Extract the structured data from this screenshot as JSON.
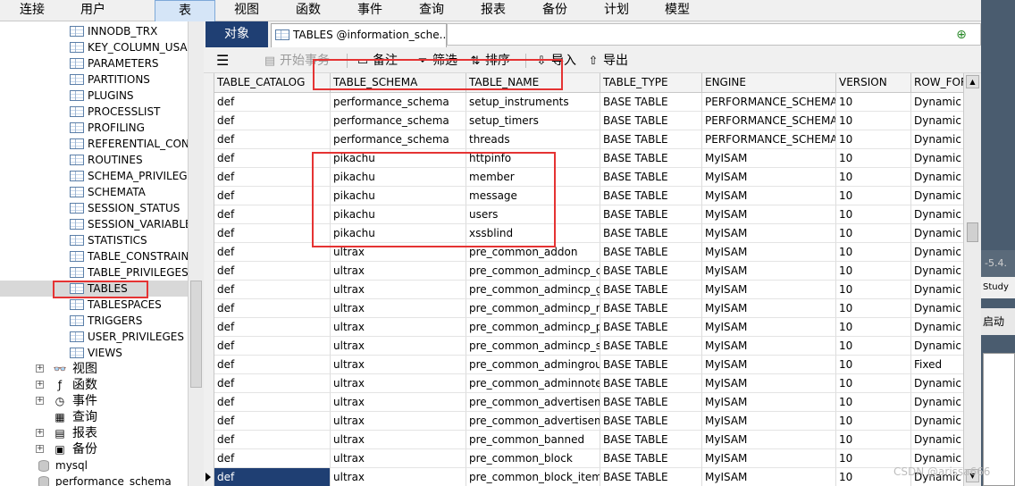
{
  "menu": [
    "连接",
    "用户",
    "表",
    "视图",
    "函数",
    "事件",
    "查询",
    "报表",
    "备份",
    "计划",
    "模型"
  ],
  "menu_active_index": 2,
  "tree": {
    "tables": [
      "INNODB_TRX",
      "KEY_COLUMN_USAGE",
      "PARAMETERS",
      "PARTITIONS",
      "PLUGINS",
      "PROCESSLIST",
      "PROFILING",
      "REFERENTIAL_CONSTRAINTS",
      "ROUTINES",
      "SCHEMA_PRIVILEGES",
      "SCHEMATA",
      "SESSION_STATUS",
      "SESSION_VARIABLES",
      "STATISTICS",
      "TABLE_CONSTRAINTS",
      "TABLE_PRIVILEGES",
      "TABLES",
      "TABLESPACES",
      "TRIGGERS",
      "USER_PRIVILEGES",
      "VIEWS"
    ],
    "selected_table": "TABLES",
    "groups": [
      {
        "label": "视图",
        "icon": "glasses-icon"
      },
      {
        "label": "函数",
        "icon": "function-icon"
      },
      {
        "label": "事件",
        "icon": "event-icon"
      },
      {
        "label": "查询",
        "icon": "query-icon"
      },
      {
        "label": "报表",
        "icon": "report-icon"
      },
      {
        "label": "备份",
        "icon": "backup-icon"
      }
    ],
    "databases": [
      "mysql",
      "performance_schema"
    ]
  },
  "tabs": {
    "objects": "对象",
    "tables_tab": "TABLES @information_sche..."
  },
  "toolbar": {
    "menu_icon": "hamburger-icon",
    "begin_tx": "开始事务",
    "note": "备注",
    "filter": "筛选",
    "sort": "排序",
    "import": "导入",
    "export": "导出"
  },
  "grid": {
    "columns": [
      "TABLE_CATALOG",
      "TABLE_SCHEMA",
      "TABLE_NAME",
      "TABLE_TYPE",
      "ENGINE",
      "VERSION",
      "ROW_FORMAT"
    ],
    "rows": [
      [
        "def",
        "performance_schema",
        "setup_instruments",
        "BASE TABLE",
        "PERFORMANCE_SCHEMA",
        "10",
        "Dynamic"
      ],
      [
        "def",
        "performance_schema",
        "setup_timers",
        "BASE TABLE",
        "PERFORMANCE_SCHEMA",
        "10",
        "Dynamic"
      ],
      [
        "def",
        "performance_schema",
        "threads",
        "BASE TABLE",
        "PERFORMANCE_SCHEMA",
        "10",
        "Dynamic"
      ],
      [
        "def",
        "pikachu",
        "httpinfo",
        "BASE TABLE",
        "MyISAM",
        "10",
        "Dynamic"
      ],
      [
        "def",
        "pikachu",
        "member",
        "BASE TABLE",
        "MyISAM",
        "10",
        "Dynamic"
      ],
      [
        "def",
        "pikachu",
        "message",
        "BASE TABLE",
        "MyISAM",
        "10",
        "Dynamic"
      ],
      [
        "def",
        "pikachu",
        "users",
        "BASE TABLE",
        "MyISAM",
        "10",
        "Dynamic"
      ],
      [
        "def",
        "pikachu",
        "xssblind",
        "BASE TABLE",
        "MyISAM",
        "10",
        "Dynamic"
      ],
      [
        "def",
        "ultrax",
        "pre_common_addon",
        "BASE TABLE",
        "MyISAM",
        "10",
        "Dynamic"
      ],
      [
        "def",
        "ultrax",
        "pre_common_admincp_cmenu",
        "BASE TABLE",
        "MyISAM",
        "10",
        "Dynamic"
      ],
      [
        "def",
        "ultrax",
        "pre_common_admincp_group",
        "BASE TABLE",
        "MyISAM",
        "10",
        "Dynamic"
      ],
      [
        "def",
        "ultrax",
        "pre_common_admincp_member",
        "BASE TABLE",
        "MyISAM",
        "10",
        "Dynamic"
      ],
      [
        "def",
        "ultrax",
        "pre_common_admincp_perm",
        "BASE TABLE",
        "MyISAM",
        "10",
        "Dynamic"
      ],
      [
        "def",
        "ultrax",
        "pre_common_admincp_session",
        "BASE TABLE",
        "MyISAM",
        "10",
        "Dynamic"
      ],
      [
        "def",
        "ultrax",
        "pre_common_admingroup",
        "BASE TABLE",
        "MyISAM",
        "10",
        "Fixed"
      ],
      [
        "def",
        "ultrax",
        "pre_common_adminnote",
        "BASE TABLE",
        "MyISAM",
        "10",
        "Dynamic"
      ],
      [
        "def",
        "ultrax",
        "pre_common_advertisement",
        "BASE TABLE",
        "MyISAM",
        "10",
        "Dynamic"
      ],
      [
        "def",
        "ultrax",
        "pre_common_advertisement_custom",
        "BASE TABLE",
        "MyISAM",
        "10",
        "Dynamic"
      ],
      [
        "def",
        "ultrax",
        "pre_common_banned",
        "BASE TABLE",
        "MyISAM",
        "10",
        "Dynamic"
      ],
      [
        "def",
        "ultrax",
        "pre_common_block",
        "BASE TABLE",
        "MyISAM",
        "10",
        "Dynamic"
      ],
      [
        "def",
        "ultrax",
        "pre_common_block_item",
        "BASE TABLE",
        "MyISAM",
        "10",
        "Dynamic"
      ]
    ],
    "selected_row": 20
  },
  "background_window": {
    "version_text": "-5.4.",
    "study_text": "Study",
    "start_text": "启动"
  },
  "watermark": "CSDN @arissa666",
  "colors": {
    "highlight_red": "#e53333",
    "selection_blue": "#1f3f73",
    "active_menu": "#d5e5f7"
  }
}
